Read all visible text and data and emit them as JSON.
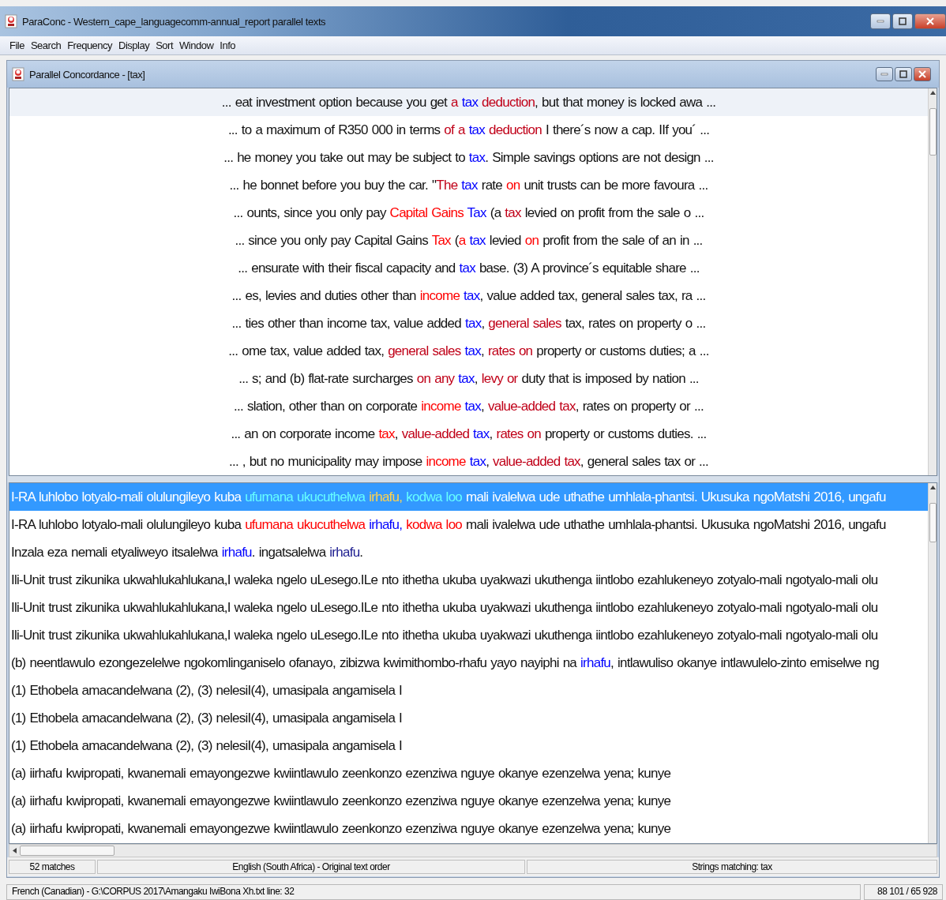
{
  "window": {
    "title": "ParaConc - Western_cape_languagecomm-annual_report parallel texts"
  },
  "menu": [
    "File",
    "Search",
    "Frequency",
    "Display",
    "Sort",
    "Window",
    "Info"
  ],
  "child_window": {
    "title": "Parallel Concordance - [tax]"
  },
  "source_lines": [
    {
      "selected": true,
      "segments": [
        {
          "text": "... eat investment option because you get "
        },
        {
          "text": "a ",
          "color": "#c00018"
        },
        {
          "text": "tax ",
          "color": "#0000ff"
        },
        {
          "text": "deduction",
          "color": "#c00018"
        },
        {
          "text": ", but that money is locked awa ..."
        }
      ]
    },
    {
      "selected": false,
      "segments": [
        {
          "text": "...  to a maximum of R350 000 in terms "
        },
        {
          "text": "of a ",
          "color": "#c00018"
        },
        {
          "text": "tax ",
          "color": "#0000ff"
        },
        {
          "text": "deduction",
          "color": "#c00018"
        },
        {
          "text": " I there´s now a cap. IIf you´ ..."
        }
      ]
    },
    {
      "selected": false,
      "segments": [
        {
          "text": "... he money you take out may be subject to "
        },
        {
          "text": "tax",
          "color": "#0000ff"
        },
        {
          "text": ". Simple savings options are not design ..."
        }
      ]
    },
    {
      "selected": false,
      "segments": [
        {
          "text": "... he bonnet before you buy the car. \""
        },
        {
          "text": "The ",
          "color": "#c00018"
        },
        {
          "text": "tax",
          "color": "#0000ff"
        },
        {
          "text": " rate "
        },
        {
          "text": "on",
          "color": "#ff0000"
        },
        {
          "text": " unit trusts can be more favoura ..."
        }
      ]
    },
    {
      "selected": false,
      "segments": [
        {
          "text": "... ounts, since you only pay "
        },
        {
          "text": "Capital Gains ",
          "color": "#ff0000"
        },
        {
          "text": "Tax",
          "color": "#0000ff"
        },
        {
          "text": " (a "
        },
        {
          "text": "tax",
          "color": "#c00018"
        },
        {
          "text": " levied on profit from the sale o ..."
        }
      ]
    },
    {
      "selected": false,
      "segments": [
        {
          "text": "... since you only pay Capital Gains "
        },
        {
          "text": "Tax",
          "color": "#ff0000"
        },
        {
          "text": " ("
        },
        {
          "text": "a ",
          "color": "#ff0000"
        },
        {
          "text": "tax",
          "color": "#0000ff"
        },
        {
          "text": " levied "
        },
        {
          "text": "on",
          "color": "#ff0000"
        },
        {
          "text": " profit from the sale of an in ..."
        }
      ]
    },
    {
      "selected": false,
      "segments": [
        {
          "text": "... ensurate with their fiscal capacity and "
        },
        {
          "text": "tax",
          "color": "#0000ff"
        },
        {
          "text": " base. (3) A province´s equitable share ..."
        }
      ]
    },
    {
      "selected": false,
      "segments": [
        {
          "text": "... es, levies and duties other than "
        },
        {
          "text": "income ",
          "color": "#ff0000"
        },
        {
          "text": "tax",
          "color": "#0000ff"
        },
        {
          "text": ", value added tax, general sales tax, ra ..."
        }
      ]
    },
    {
      "selected": false,
      "segments": [
        {
          "text": "... ties other than income tax, value added "
        },
        {
          "text": "tax",
          "color": "#0000ff"
        },
        {
          "text": ", "
        },
        {
          "text": "general sales",
          "color": "#c00018"
        },
        {
          "text": " tax, rates on property o ..."
        }
      ]
    },
    {
      "selected": false,
      "segments": [
        {
          "text": "... ome tax, value added tax, "
        },
        {
          "text": "general sales ",
          "color": "#c00018"
        },
        {
          "text": "tax",
          "color": "#0000ff"
        },
        {
          "text": ", "
        },
        {
          "text": "rates on",
          "color": "#c00018"
        },
        {
          "text": " property or customs duties; a ..."
        }
      ]
    },
    {
      "selected": false,
      "segments": [
        {
          "text": "... s; and (b) flat-rate surcharges "
        },
        {
          "text": "on any ",
          "color": "#c00018"
        },
        {
          "text": "tax",
          "color": "#0000ff"
        },
        {
          "text": ", "
        },
        {
          "text": "levy or",
          "color": "#c00018"
        },
        {
          "text": " duty that is imposed by nation ..."
        }
      ]
    },
    {
      "selected": false,
      "segments": [
        {
          "text": "... slation, other than on corporate "
        },
        {
          "text": "income ",
          "color": "#ff0000"
        },
        {
          "text": "tax",
          "color": "#0000ff"
        },
        {
          "text": ", "
        },
        {
          "text": "value-added tax",
          "color": "#c00018"
        },
        {
          "text": ", rates on property or  ..."
        }
      ]
    },
    {
      "selected": false,
      "segments": [
        {
          "text": "... an on corporate income "
        },
        {
          "text": "tax",
          "color": "#ff0000"
        },
        {
          "text": ", "
        },
        {
          "text": "value-added ",
          "color": "#c00018"
        },
        {
          "text": "tax",
          "color": "#0000ff"
        },
        {
          "text": ", "
        },
        {
          "text": "rates on",
          "color": "#c00018"
        },
        {
          "text": " property or customs duties.  ..."
        }
      ]
    },
    {
      "selected": false,
      "segments": [
        {
          "text": "... , but no municipality may impose "
        },
        {
          "text": "income ",
          "color": "#ff0000"
        },
        {
          "text": "tax",
          "color": "#0000ff"
        },
        {
          "text": ", "
        },
        {
          "text": "value-added tax",
          "color": "#c00018"
        },
        {
          "text": ", general sales tax or  ..."
        }
      ]
    }
  ],
  "target_lines": [
    {
      "selected": true,
      "segments": [
        {
          "text": "I-RA luhlobo lotyalo-mali olulungileyo kuba "
        },
        {
          "text": "ufumana ukucuthelwa ",
          "color": "#66ffff"
        },
        {
          "text": "irhafu, ",
          "color": "#ffd24d"
        },
        {
          "text": "kodwa loo",
          "color": "#66ffff"
        },
        {
          "text": " mali ivalelwa ude uthathe umhlala-phantsi. Ukusuka ngoMatshi 2016, ungafu"
        }
      ]
    },
    {
      "selected": false,
      "segments": [
        {
          "text": "I-RA luhlobo lotyalo-mali olulungileyo kuba "
        },
        {
          "text": "ufumana ukucuthelwa ",
          "color": "#ff0000"
        },
        {
          "text": "irhafu, ",
          "color": "#0000ff"
        },
        {
          "text": "kodwa loo",
          "color": "#ff0000"
        },
        {
          "text": " mali ivalelwa ude uthathe umhlala-phantsi. Ukusuka ngoMatshi 2016, ungafu"
        }
      ]
    },
    {
      "selected": false,
      "segments": [
        {
          "text": "Inzala eza nemali etyaliweyo itsalelwa "
        },
        {
          "text": "irhafu",
          "color": "#0000ff"
        },
        {
          "text": ". ingatsalelwa "
        },
        {
          "text": "irhafu",
          "color": "#202090"
        },
        {
          "text": "."
        }
      ]
    },
    {
      "selected": false,
      "segments": [
        {
          "text": "Ili-Unit trust zikunika ukwahlukahlukana,I waleka ngelo uLesego.ILe nto ithetha ukuba uyakwazi ukuthenga iintlobo ezahlukeneyo zotyalo-mali ngotyalo-mali olu"
        }
      ]
    },
    {
      "selected": false,
      "segments": [
        {
          "text": "Ili-Unit trust zikunika ukwahlukahlukana,I waleka ngelo uLesego.ILe nto ithetha ukuba uyakwazi ukuthenga iintlobo ezahlukeneyo zotyalo-mali ngotyalo-mali olu"
        }
      ]
    },
    {
      "selected": false,
      "segments": [
        {
          "text": "Ili-Unit trust zikunika ukwahlukahlukana,I waleka ngelo uLesego.ILe nto ithetha ukuba uyakwazi ukuthenga iintlobo ezahlukeneyo zotyalo-mali ngotyalo-mali olu"
        }
      ]
    },
    {
      "selected": false,
      "segments": [
        {
          "text": "(b) neentlawulo ezongezelelwe ngokomlinganiselo ofanayo, zibizwa kwimithombo-rhafu yayo nayiphi na "
        },
        {
          "text": "irhafu",
          "color": "#0000ff"
        },
        {
          "text": ", intlawuliso okanye intlawulelo-zinto emiselwe ng"
        }
      ]
    },
    {
      "selected": false,
      "segments": [
        {
          "text": "(1) Ethobela amacandelwana (2), (3) nelesiI(4), umasipala angamisela I"
        }
      ]
    },
    {
      "selected": false,
      "segments": [
        {
          "text": "(1) Ethobela amacandelwana (2), (3) nelesiI(4), umasipala angamisela I"
        }
      ]
    },
    {
      "selected": false,
      "segments": [
        {
          "text": "(1) Ethobela amacandelwana (2), (3) nelesiI(4), umasipala angamisela I"
        }
      ]
    },
    {
      "selected": false,
      "segments": [
        {
          "text": "(a) iirhafu kwipropati, kwanemali emayongezwe kwiintlawulo zeenkonzo ezenziwa nguye okanye ezenzelwa yena; kunye"
        }
      ]
    },
    {
      "selected": false,
      "segments": [
        {
          "text": "(a) iirhafu kwipropati, kwanemali emayongezwe kwiintlawulo zeenkonzo ezenziwa nguye okanye ezenzelwa yena; kunye"
        }
      ]
    },
    {
      "selected": false,
      "segments": [
        {
          "text": "(a) iirhafu kwipropati, kwanemali emayongezwe kwiintlawulo zeenkonzo ezenziwa nguye okanye ezenzelwa yena; kunye"
        }
      ]
    }
  ],
  "child_status_bar": [
    "52 matches",
    "English (South Africa) - Original text order",
    "Strings matching: tax"
  ],
  "status_bar": [
    "French (Canadian) - G:\\CORPUS 2017\\Amangaku IwiBona Xh.txt  line: 32",
    "88 101 / 65 928"
  ]
}
